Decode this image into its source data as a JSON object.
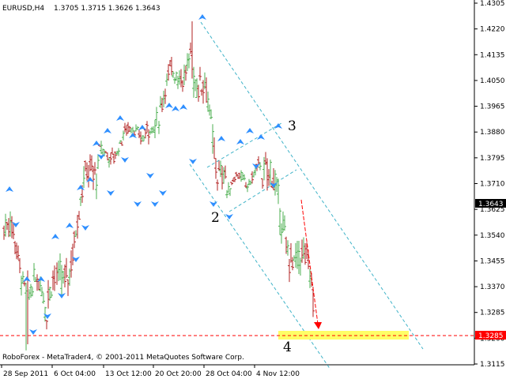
{
  "header": {
    "symbol_timeframe": "EURUSD,H4",
    "ohlc": "1.3705 1.3715 1.3626 1.3643"
  },
  "footer": {
    "copyright": "RoboForex - MetaTrader4, © 2001-2011 MetaQuotes Software Corp."
  },
  "price_axis": {
    "ticks": [
      "1.4305",
      "1.4220",
      "1.4135",
      "1.4050",
      "1.3965",
      "1.3880",
      "1.3795",
      "1.3710",
      "1.3625",
      "1.3540",
      "1.3455",
      "1.3370",
      "1.3285",
      "1.3200",
      "1.3115"
    ],
    "current_price": "1.3643",
    "target_price": "1.3285"
  },
  "time_axis": {
    "ticks": [
      "28 Sep 2011",
      "6 Oct 04:00",
      "13 Oct 12:00",
      "20 Oct 20:00",
      "28 Oct 04:00",
      "4 Nov 12:00"
    ]
  },
  "wave_labels": [
    "2",
    "3",
    "4"
  ],
  "colors": {
    "background": "#ffffff",
    "bull_bar": "#4caf50",
    "bear_bar": "#b22222",
    "fractal_arrow": "#2f8fff",
    "channel_line": "#3fb3c8",
    "target_zone": "#ffff66",
    "forecast_arrow": "#ff0000",
    "target_line": "#ff0000",
    "price_tag_bg": "#000000",
    "target_tag_bg": "#ff0000"
  },
  "chart_data": {
    "type": "ohlc",
    "symbol": "EURUSD",
    "timeframe": "H4",
    "ylim": [
      1.3115,
      1.4305
    ],
    "ohlc_segments": [
      {
        "from": "28 Sep 2011",
        "to": "4 Oct",
        "open": 1.356,
        "high": 1.372,
        "low": 1.316,
        "close": 1.328
      },
      {
        "from": "4 Oct",
        "to": "13 Oct 12:00",
        "open": 1.328,
        "high": 1.39,
        "low": 1.323,
        "close": 1.38
      },
      {
        "from": "13 Oct 12:00",
        "to": "20 Oct 20:00",
        "open": 1.38,
        "high": 1.395,
        "low": 1.365,
        "close": 1.39
      },
      {
        "from": "20 Oct 20:00",
        "to": "27 Oct",
        "open": 1.39,
        "high": 1.4245,
        "low": 1.38,
        "close": 1.415
      },
      {
        "from": "27 Oct",
        "to": "1 Nov",
        "open": 1.415,
        "high": 1.422,
        "low": 1.361,
        "close": 1.37
      },
      {
        "from": "1 Nov",
        "to": "7 Nov",
        "open": 1.37,
        "high": 1.389,
        "low": 1.365,
        "close": 1.375
      },
      {
        "from": "7 Nov",
        "to": "10 Nov",
        "open": 1.375,
        "high": 1.388,
        "low": 1.327,
        "close": 1.334
      }
    ],
    "last_bar": {
      "open": 1.3705,
      "high": 1.3715,
      "low": 1.3626,
      "close": 1.3643
    },
    "annotations": [
      {
        "type": "wave_label",
        "text": "2",
        "price": 1.361
      },
      {
        "type": "wave_label",
        "text": "3",
        "price": 1.388
      },
      {
        "type": "wave_label",
        "text": "4",
        "price": 1.327
      },
      {
        "type": "target_zone",
        "price": 1.3285
      },
      {
        "type": "horizontal_line",
        "price": 1.3285,
        "style": "dashed",
        "color": "#ff0000"
      }
    ]
  }
}
